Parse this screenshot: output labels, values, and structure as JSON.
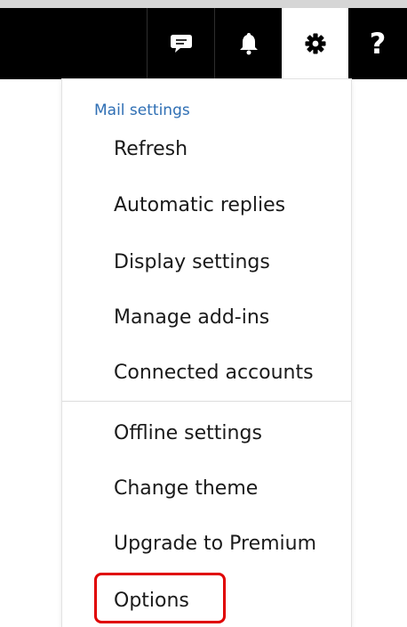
{
  "toolbar": {
    "buttons": [
      {
        "name": "chat-button",
        "icon": "chat-bubble-icon"
      },
      {
        "name": "notifications-button",
        "icon": "bell-icon"
      },
      {
        "name": "settings-button",
        "icon": "gear-icon",
        "active": true
      },
      {
        "name": "help-button",
        "icon": "question-mark-icon",
        "label": "?"
      }
    ]
  },
  "menu": {
    "header": "Mail settings",
    "items": [
      {
        "label": "Refresh"
      },
      {
        "label": "Automatic replies"
      },
      {
        "label": "Display settings"
      },
      {
        "label": "Manage add-ins"
      },
      {
        "label": "Connected accounts"
      },
      {
        "label": "Offline settings"
      },
      {
        "label": "Change theme"
      },
      {
        "label": "Upgrade to Premium"
      },
      {
        "label": "Options",
        "highlighted": true
      }
    ]
  },
  "colors": {
    "topbar": "#000000",
    "header_text": "#2f6fb4",
    "highlight_border": "#e00000"
  }
}
